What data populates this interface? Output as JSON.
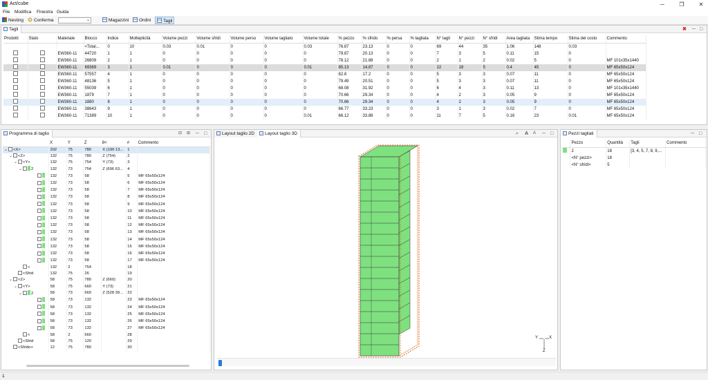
{
  "window": {
    "title": "Act/cube",
    "minimize": "─",
    "maximize": "❐",
    "close": "✕"
  },
  "menu": [
    "File",
    "Modifica",
    "Finestra",
    "Guida"
  ],
  "toolbar": {
    "nesting": "Nesting",
    "conferma": "Conferma",
    "combo_value": "",
    "magazzini": "Magazzini",
    "ordini": "Ordini",
    "tagli": "Tagli"
  },
  "tagli_panel": {
    "tab": "Tagli",
    "columns": [
      "Prodotti",
      "Stato",
      "Materiale",
      "Blocco",
      "Indice",
      "Molteplicità",
      "Volume pezzi",
      "Volume sfridi",
      "Volume perso",
      "Volume tagliato",
      "Volume totale",
      "% pezzo",
      "% sfrido",
      "% persa",
      "% tagliata",
      "N° tagli",
      "N° pezzi",
      "N° sfridi",
      "Area tagliata",
      "Stima tempo",
      "Stima del costo",
      "Commento"
    ],
    "total_row": [
      "",
      "",
      "",
      "<Total...",
      "0",
      "10",
      "0.03",
      "0.01",
      "0",
      "0",
      "0.03",
      "76.87",
      "23.13",
      "0",
      "0",
      "69",
      "44",
      "35",
      "1.06",
      "148",
      "0.03",
      ""
    ],
    "rows": [
      [
        "EW360-11",
        "44720",
        "1",
        "1",
        "0",
        "0",
        "0",
        "0",
        "0",
        "79.87",
        "20.13",
        "0",
        "0",
        "7",
        "3",
        "5",
        "0.11",
        "15",
        "0",
        ""
      ],
      [
        "EW360-11",
        "26809",
        "2",
        "1",
        "0",
        "0",
        "0",
        "0",
        "0",
        "78.12",
        "21.88",
        "0",
        "0",
        "2",
        "1",
        "2",
        "0.02",
        "5",
        "0",
        "MF 101x35x1440"
      ],
      [
        "EW360-11",
        "69369",
        "3",
        "1",
        "0.01",
        "0",
        "0",
        "0",
        "0.01",
        "85.13",
        "14.87",
        "0",
        "0",
        "22",
        "18",
        "5",
        "0.4",
        "45",
        "0",
        "MF 65x50x124"
      ],
      [
        "EW360-11",
        "57557",
        "4",
        "1",
        "0",
        "0",
        "0",
        "0",
        "0",
        "82.8",
        "17.2",
        "0",
        "0",
        "5",
        "3",
        "3",
        "0.07",
        "11",
        "0",
        "MF 65x50x124"
      ],
      [
        "EW360-11",
        "48136",
        "5",
        "1",
        "0",
        "0",
        "0",
        "0",
        "0",
        "79.49",
        "20.51",
        "0",
        "0",
        "5",
        "3",
        "3",
        "0.07",
        "11",
        "0",
        "MF 65x50x124"
      ],
      [
        "EW360-11",
        "55039",
        "6",
        "1",
        "0",
        "0",
        "0",
        "0",
        "0",
        "68.08",
        "31.92",
        "0",
        "0",
        "6",
        "4",
        "3",
        "0.11",
        "13",
        "0",
        "MF 101x35x1440"
      ],
      [
        "EW360-11",
        "1879",
        "7",
        "1",
        "0",
        "0",
        "0",
        "0",
        "0",
        "70.66",
        "29.34",
        "0",
        "0",
        "4",
        "2",
        "3",
        "0.05",
        "9",
        "0",
        "MF 65x50x124"
      ],
      [
        "EW360-11",
        "1880",
        "8",
        "1",
        "0",
        "0",
        "0",
        "0",
        "0",
        "70.66",
        "29.34",
        "0",
        "0",
        "4",
        "2",
        "3",
        "0.05",
        "9",
        "0",
        "MF 65x50x124"
      ],
      [
        "EW360-11",
        "38643",
        "9",
        "1",
        "0",
        "0",
        "0",
        "0",
        "0",
        "66.77",
        "33.23",
        "0",
        "0",
        "3",
        "1",
        "3",
        "0.02",
        "7",
        "0",
        "MF 65x50x124"
      ],
      [
        "EW360-11",
        "71389",
        "10",
        "1",
        "0",
        "0",
        "0",
        "0",
        "0.01",
        "66.12",
        "33.88",
        "0",
        "0",
        "11",
        "7",
        "5",
        "0.16",
        "23",
        "0.01",
        "MF 65x50x124"
      ]
    ]
  },
  "programma_panel": {
    "tab": "Programma di taglio",
    "columns": [
      "",
      "X",
      "Y",
      "Z",
      "8<",
      "#",
      "Commento"
    ],
    "rows": [
      {
        "label": "<X>",
        "x": "202",
        "y": "75",
        "z": "780",
        "cut": "X (190 13...",
        "n": "1",
        "c": ""
      },
      {
        "label": "<Z>",
        "x": "132",
        "y": "75",
        "z": "780",
        "cut": "Z (754)",
        "n": "2",
        "c": ""
      },
      {
        "label": "<Y>",
        "x": "132",
        "y": "75",
        "z": "754",
        "cut": "Y (73)",
        "n": "3",
        "c": ""
      },
      {
        "label": "2",
        "x": "132",
        "y": "73",
        "z": "754",
        "cut": "Z (696 63...",
        "n": "4",
        "c": ""
      },
      {
        "label": "",
        "x": "132",
        "y": "73",
        "z": "58",
        "cut": "",
        "n": "5",
        "c": "MF 65x50x124"
      },
      {
        "label": "",
        "x": "132",
        "y": "73",
        "z": "58",
        "cut": "",
        "n": "6",
        "c": "MF 65x50x124"
      },
      {
        "label": "",
        "x": "132",
        "y": "73",
        "z": "58",
        "cut": "",
        "n": "7",
        "c": "MF 65x50x124"
      },
      {
        "label": "",
        "x": "132",
        "y": "73",
        "z": "58",
        "cut": "",
        "n": "8",
        "c": "MF 65x50x124"
      },
      {
        "label": "",
        "x": "132",
        "y": "73",
        "z": "58",
        "cut": "",
        "n": "9",
        "c": "MF 65x50x124"
      },
      {
        "label": "",
        "x": "132",
        "y": "73",
        "z": "58",
        "cut": "",
        "n": "10",
        "c": "MF 65x50x124"
      },
      {
        "label": "",
        "x": "132",
        "y": "73",
        "z": "58",
        "cut": "",
        "n": "11",
        "c": "MF 65x50x124"
      },
      {
        "label": "",
        "x": "132",
        "y": "73",
        "z": "58",
        "cut": "",
        "n": "12",
        "c": "MF 65x50x124"
      },
      {
        "label": "",
        "x": "132",
        "y": "73",
        "z": "58",
        "cut": "",
        "n": "13",
        "c": "MF 65x50x124"
      },
      {
        "label": "",
        "x": "132",
        "y": "73",
        "z": "58",
        "cut": "",
        "n": "14",
        "c": "MF 65x50x124"
      },
      {
        "label": "",
        "x": "132",
        "y": "73",
        "z": "58",
        "cut": "",
        "n": "15",
        "c": "MF 65x50x124"
      },
      {
        "label": "",
        "x": "132",
        "y": "73",
        "z": "58",
        "cut": "",
        "n": "16",
        "c": "MF 65x50x124"
      },
      {
        "label": "",
        "x": "132",
        "y": "73",
        "z": "58",
        "cut": "",
        "n": "17",
        "c": "MF 65x50x124"
      },
      {
        "label": "<",
        "x": "132",
        "y": "2",
        "z": "754",
        "cut": "",
        "n": "18",
        "c": ""
      },
      {
        "label": "<Sfrid",
        "x": "132",
        "y": "75",
        "z": "26",
        "cut": "",
        "n": "19",
        "c": ""
      },
      {
        "label": "<Z>",
        "x": "58",
        "y": "75",
        "z": "780",
        "cut": "Z (660)",
        "n": "20",
        "c": ""
      },
      {
        "label": "<Y>",
        "x": "58",
        "y": "75",
        "z": "660",
        "cut": "Y (73)",
        "n": "21",
        "c": ""
      },
      {
        "label": "2",
        "x": "58",
        "y": "73",
        "z": "660",
        "cut": "Z (528 39...",
        "n": "22",
        "c": ""
      },
      {
        "label": "",
        "x": "58",
        "y": "73",
        "z": "132",
        "cut": "",
        "n": "23",
        "c": "MF 65x50x124"
      },
      {
        "label": "",
        "x": "58",
        "y": "73",
        "z": "132",
        "cut": "",
        "n": "24",
        "c": "MF 65x50x124"
      },
      {
        "label": "",
        "x": "58",
        "y": "73",
        "z": "132",
        "cut": "",
        "n": "25",
        "c": "MF 65x50x124"
      },
      {
        "label": "",
        "x": "58",
        "y": "73",
        "z": "132",
        "cut": "",
        "n": "26",
        "c": "MF 65x50x124"
      },
      {
        "label": "",
        "x": "58",
        "y": "73",
        "z": "132",
        "cut": "",
        "n": "27",
        "c": "MF 65x50x124"
      },
      {
        "label": "<",
        "x": "58",
        "y": "2",
        "z": "660",
        "cut": "",
        "n": "28",
        "c": ""
      },
      {
        "label": "<Sfrid",
        "x": "58",
        "y": "75",
        "z": "120",
        "cut": "",
        "n": "29",
        "c": ""
      },
      {
        "label": "<Sfrido>",
        "x": "12",
        "y": "75",
        "z": "780",
        "cut": "",
        "n": "30",
        "c": ""
      }
    ]
  },
  "layout_panel": {
    "tab2d": "Layout taglio 2D",
    "tab3d": "Layout taglio 3D",
    "axis_y": "Y",
    "axis_x": "X",
    "axis_z": "Z",
    "piece_color": "#7fe07f",
    "outline_color": "#e0661a"
  },
  "pezzi_panel": {
    "tab": "Pezzi tagliati",
    "columns": [
      "",
      "Pezzo",
      "Quantità",
      "Tagli",
      "Commento"
    ],
    "rows": [
      {
        "pezzo": "2",
        "qta": "18",
        "tagli": "[3, 4, 5, 7, 8, 9,...",
        "c": ""
      },
      {
        "pezzo": "<N° pezzi>",
        "qta": "18",
        "tagli": "",
        "c": ""
      },
      {
        "pezzo": "<N° sfridi>",
        "qta": "5",
        "tagli": "",
        "c": ""
      }
    ]
  },
  "status": {
    "text": "1"
  }
}
